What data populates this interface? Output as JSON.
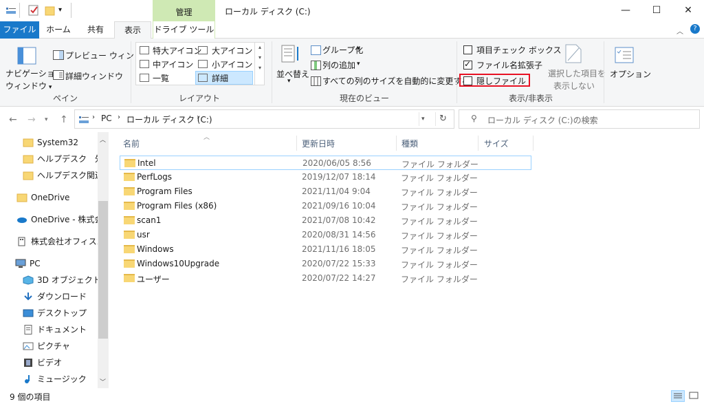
{
  "window": {
    "title": "ローカル ディスク (C:)",
    "context_tab": "管理",
    "minimize": "—",
    "maximize": "☐",
    "close": "✕"
  },
  "tabs": {
    "file": "ファイル",
    "home": "ホーム",
    "share": "共有",
    "view": "表示",
    "drive_tools": "ドライブ ツール"
  },
  "ribbon": {
    "panes": {
      "nav_pane_line1": "ナビゲーション",
      "nav_pane_line2": "ウィンドウ",
      "preview_pane": "プレビュー ウィンドウ",
      "details_pane": "詳細ウィンドウ",
      "group_label": "ペイン"
    },
    "layout": {
      "extra_large": "特大アイコン",
      "large": "大アイコン",
      "medium": "中アイコン",
      "small": "小アイコン",
      "list": "一覧",
      "details": "詳細",
      "group_label": "レイアウト"
    },
    "current_view": {
      "sort_by": "並べ替え",
      "group_by": "グループ化",
      "add_columns": "列の追加",
      "size_all_columns": "すべての列のサイズを自動的に変更する",
      "group_label": "現在のビュー"
    },
    "show_hide": {
      "item_checkboxes": "項目チェック ボックス",
      "file_extensions": "ファイル名拡張子",
      "hidden_items": "隠しファイル",
      "hide_selected_line1": "選択した項目を",
      "hide_selected_line2": "表示しない",
      "group_label": "表示/非表示",
      "item_checkboxes_checked": false,
      "file_extensions_checked": true,
      "hidden_items_checked": false
    },
    "options": "オプション"
  },
  "address": {
    "pc": "PC",
    "drive": "ローカル ディスク (C:)",
    "search_placeholder": "ローカル ディスク (C:)の検索"
  },
  "nav_pane": [
    {
      "label": "System32",
      "kind": "folder"
    },
    {
      "label": "ヘルプデスク　外注",
      "kind": "folder"
    },
    {
      "label": "ヘルプデスク関連",
      "kind": "folder"
    },
    {
      "label": "OneDrive",
      "kind": "folder"
    },
    {
      "label": "OneDrive - 株式会",
      "kind": "cloud"
    },
    {
      "label": "株式会社オフィスバ",
      "kind": "building"
    },
    {
      "label": "PC",
      "kind": "pc"
    },
    {
      "label": "3D オブジェクト",
      "kind": "cube"
    },
    {
      "label": "ダウンロード",
      "kind": "download"
    },
    {
      "label": "デスクトップ",
      "kind": "desktop"
    },
    {
      "label": "ドキュメント",
      "kind": "document"
    },
    {
      "label": "ピクチャ",
      "kind": "picture"
    },
    {
      "label": "ビデオ",
      "kind": "video"
    },
    {
      "label": "ミュージック",
      "kind": "music"
    }
  ],
  "columns": {
    "name": "名前",
    "date": "更新日時",
    "type": "種類",
    "size": "サイズ"
  },
  "files": [
    {
      "name": "Intel",
      "date": "2020/06/05 8:56",
      "type": "ファイル フォルダー"
    },
    {
      "name": "PerfLogs",
      "date": "2019/12/07 18:14",
      "type": "ファイル フォルダー"
    },
    {
      "name": "Program Files",
      "date": "2021/11/04 9:04",
      "type": "ファイル フォルダー"
    },
    {
      "name": "Program Files (x86)",
      "date": "2021/09/16 10:04",
      "type": "ファイル フォルダー"
    },
    {
      "name": "scan1",
      "date": "2021/07/08 10:42",
      "type": "ファイル フォルダー"
    },
    {
      "name": "usr",
      "date": "2020/08/31 14:56",
      "type": "ファイル フォルダー"
    },
    {
      "name": "Windows",
      "date": "2021/11/16 18:05",
      "type": "ファイル フォルダー"
    },
    {
      "name": "Windows10Upgrade",
      "date": "2020/07/22 15:33",
      "type": "ファイル フォルダー"
    },
    {
      "name": "ユーザー",
      "date": "2020/07/22 14:27",
      "type": "ファイル フォルダー"
    }
  ],
  "status": {
    "item_count": "9 個の項目"
  }
}
